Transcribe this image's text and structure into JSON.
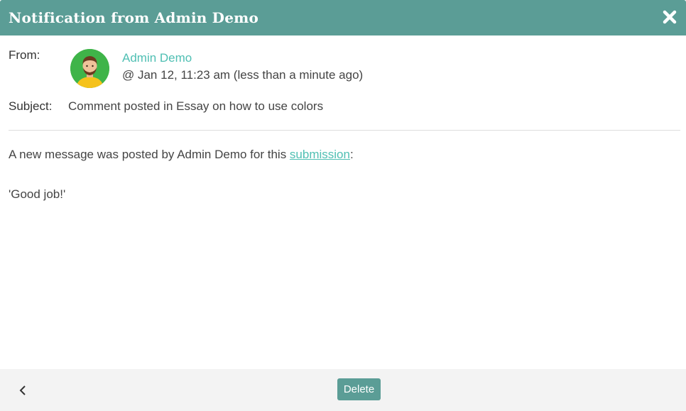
{
  "dialog": {
    "title": "Notification from Admin Demo",
    "close_icon": "close-icon"
  },
  "from": {
    "label": "From:",
    "avatar_icon": "user-avatar-icon",
    "sender_name": "Admin Demo",
    "sent_time": "@ Jan 12, 11:23 am (less than a minute ago)"
  },
  "subject": {
    "label": "Subject:",
    "text": "Comment posted in Essay on how to use colors"
  },
  "message": {
    "intro": "A new message was posted by Admin Demo for this ",
    "link_text": "submission",
    "intro_end": ":",
    "quote": "'Good job!'"
  },
  "footer": {
    "back_icon": "chevron-left-icon",
    "delete_label": "Delete"
  },
  "colors": {
    "header": "#5b9d96",
    "link": "#4fbfb3",
    "avatar_bg": "#3fb449",
    "footer_bg": "#f3f3f3"
  }
}
